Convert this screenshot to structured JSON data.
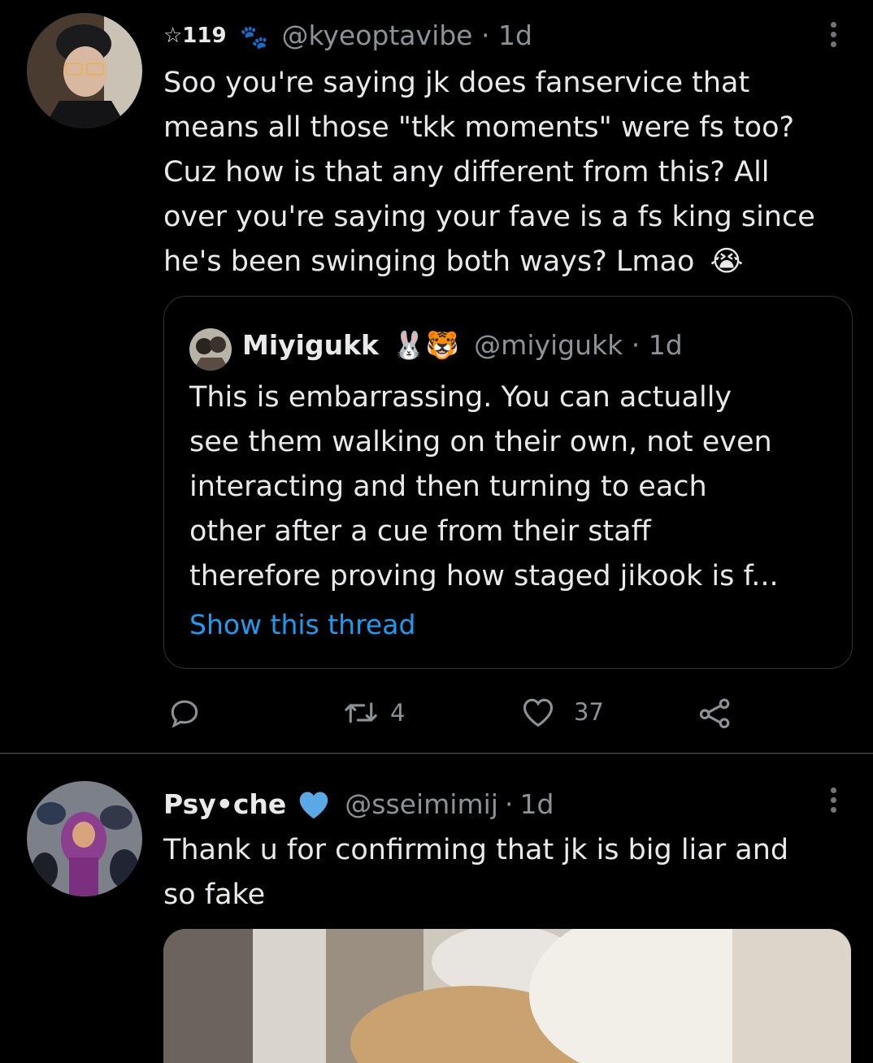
{
  "tweet1": {
    "prefix": "☆119",
    "paw_emoji": "🐾",
    "handle": "@kyeoptavibe",
    "dot": "·",
    "time": "1d",
    "lines": [
      "Soo you're saying jk does fanservice that",
      "means all those \"tkk moments\" were fs too?",
      "Cuz how is that any different from this?  All",
      "over you're saying your fave is a fs king since",
      "he's been swinging both ways? Lmao"
    ],
    "end_emoji": "😭",
    "quote": {
      "name": "Miyigukk",
      "name_emojis": "🐰🐯",
      "handle": "@miyigukk",
      "dot": "·",
      "time": "1d",
      "lines": [
        "This is embarrassing. You can actually",
        "see them walking on their own, not even",
        "interacting and then turning to each",
        "other after a cue from their staff",
        "therefore proving how staged jikook is f..."
      ],
      "show_thread": "Show this thread"
    },
    "actions": {
      "retweets": "4",
      "likes": "37"
    }
  },
  "tweet2": {
    "name": "Psy•che",
    "handle": "@sseimimij",
    "dot": "·",
    "time": "1d",
    "lines": [
      "Thank u for confirming that jk is big liar and",
      "so fake"
    ]
  },
  "colors": {
    "background": "#000000",
    "text": "#e7e9ea",
    "muted": "#8b9298",
    "link": "#1d9bf0",
    "border": "#2f3336",
    "heart_badge": "#5aa9e6"
  },
  "icons": [
    "reply-icon",
    "retweet-icon",
    "like-icon",
    "share-icon",
    "more-icon",
    "verified-heart-icon"
  ]
}
